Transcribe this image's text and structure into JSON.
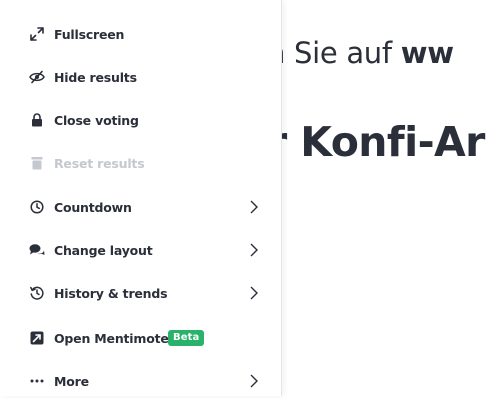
{
  "slide": {
    "line1_prefix": "n Sie auf ",
    "line1_bold": "ww",
    "line2": "r Konfi-Ar"
  },
  "menu": {
    "items": [
      {
        "label": "Fullscreen",
        "icon": "expand-arrows-icon",
        "enabled": true,
        "submenu": false
      },
      {
        "label": "Hide results",
        "icon": "eye-slash-icon",
        "enabled": true,
        "submenu": false
      },
      {
        "label": "Close voting",
        "icon": "lock-icon",
        "enabled": true,
        "submenu": false
      },
      {
        "label": "Reset results",
        "icon": "trash-icon",
        "enabled": false,
        "submenu": false
      },
      {
        "label": "Countdown",
        "icon": "clock-icon",
        "enabled": true,
        "submenu": true
      },
      {
        "label": "Change layout",
        "icon": "chat-bubbles-icon",
        "enabled": true,
        "submenu": true
      },
      {
        "label": "History & trends",
        "icon": "history-icon",
        "enabled": true,
        "submenu": true
      },
      {
        "label": "Open Mentimote",
        "icon": "mentimote-icon",
        "enabled": true,
        "submenu": false,
        "badge": "Beta"
      },
      {
        "label": "More",
        "icon": "more-dots-icon",
        "enabled": true,
        "submenu": true
      }
    ]
  },
  "colors": {
    "text": "#2b2f3a",
    "disabled": "#c5c8cf",
    "beta_badge": "#29b36a"
  }
}
